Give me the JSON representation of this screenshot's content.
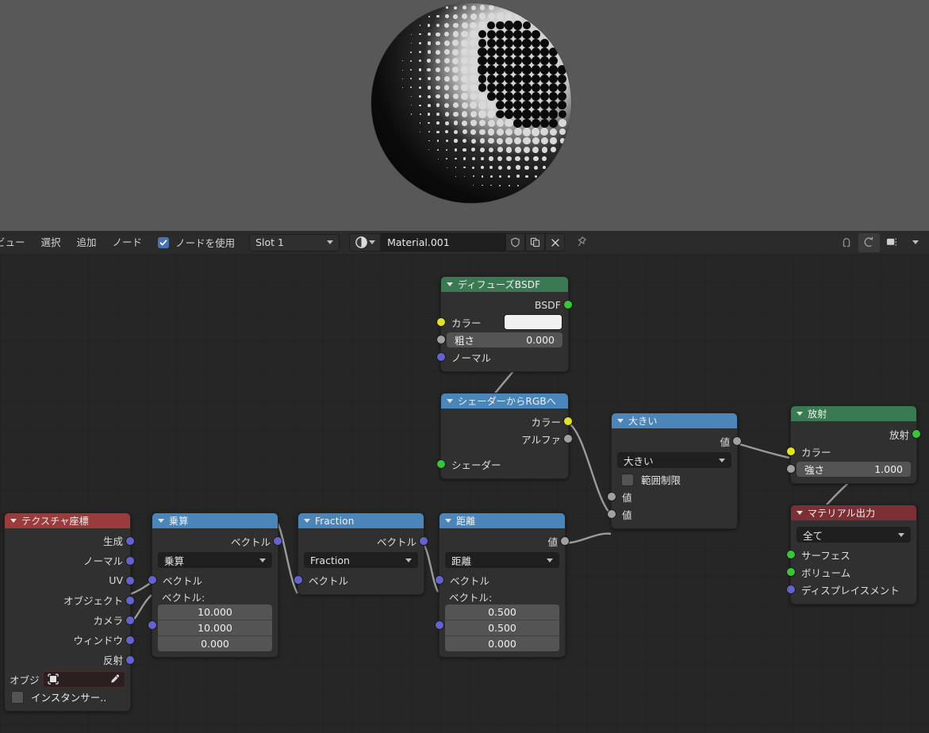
{
  "viewport": {
    "name": "material-preview-sphere",
    "description": "halftone dot shaded sphere render"
  },
  "header": {
    "menus": [
      {
        "name": "view-menu",
        "label": "ビュー"
      },
      {
        "name": "select-menu",
        "label": "選択"
      },
      {
        "name": "add-menu",
        "label": "追加"
      },
      {
        "name": "node-menu",
        "label": "ノード"
      }
    ],
    "use_nodes": {
      "label": "ノードを使用",
      "checked": true
    },
    "slot_select": {
      "label": "Slot 1"
    },
    "material_name": "Material.001",
    "buttons": {
      "fake_user": "shield-icon",
      "duplicate": "copy-icon",
      "unlink": "close-icon",
      "pin": "pin-icon",
      "snap": "snap-icon",
      "proportional": "proportional-edit-icon",
      "overlay": "overlay-icon"
    }
  },
  "nodes": {
    "diffuse": {
      "title": "ディフューズBSDF",
      "outputs": [
        {
          "label": "BSDF",
          "color": "green"
        }
      ],
      "color_label": "カラー",
      "roughness": {
        "label": "粗さ",
        "value": "0.000"
      },
      "normal_label": "ノーマル"
    },
    "shader_to_rgb": {
      "title": "シェーダーからRGBへ",
      "outputs": [
        {
          "label": "カラー",
          "color": "yellow"
        },
        {
          "label": "アルファ",
          "color": "gray"
        }
      ],
      "inputs": [
        {
          "label": "シェーダー",
          "color": "green"
        }
      ]
    },
    "greater_than": {
      "title": "大きい",
      "output_label": "値",
      "operation": "大きい",
      "clamp_label": "範囲制限",
      "input1_label": "値",
      "input2_label": "値"
    },
    "emission": {
      "title": "放射",
      "output_label": "放射",
      "color_label": "カラー",
      "strength": {
        "label": "強さ",
        "value": "1.000"
      }
    },
    "material_output": {
      "title": "マテリアル出力",
      "target": "全て",
      "inputs": [
        {
          "label": "サーフェス",
          "color": "green"
        },
        {
          "label": "ボリューム",
          "color": "green"
        },
        {
          "label": "ディスプレイスメント",
          "color": "purple"
        }
      ]
    },
    "texture_coordinate": {
      "title": "テクスチャ座標",
      "outputs": [
        {
          "label": "生成"
        },
        {
          "label": "ノーマル"
        },
        {
          "label": "UV"
        },
        {
          "label": "オブジェクト"
        },
        {
          "label": "カメラ"
        },
        {
          "label": "ウィンドウ"
        },
        {
          "label": "反射"
        }
      ],
      "object_label": "オブジ",
      "object_value": "",
      "from_instancer_label": "インスタンサー.."
    },
    "multiply": {
      "title": "乗算",
      "output_label": "ベクトル",
      "operation": "乗算",
      "input_label": "ベクトル",
      "vector_label": "ベクトル:",
      "vector_values": [
        "10.000",
        "10.000",
        "0.000"
      ]
    },
    "fraction": {
      "title": "Fraction",
      "output_label": "ベクトル",
      "operation": "Fraction",
      "input_label": "ベクトル"
    },
    "distance": {
      "title": "距離",
      "output_label": "値",
      "operation": "距離",
      "input_label": "ベクトル",
      "vector_label": "ベクトル:",
      "vector_values": [
        "0.500",
        "0.500",
        "0.000"
      ]
    }
  },
  "colors": {
    "header_green": "#3a7a52",
    "header_blue": "#4b86bb",
    "header_red": "#9c3b3b",
    "header_darkred": "#7c2f34",
    "socket_yellow": "#e2e224",
    "socket_gray": "#a1a1a1",
    "socket_purple": "#6363ce",
    "socket_green": "#39c439",
    "canvas_bg": "#262626",
    "checkbox_blue": "#4772b3"
  }
}
